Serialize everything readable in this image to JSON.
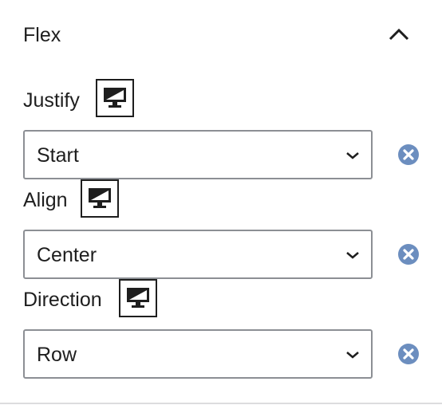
{
  "panel": {
    "title": "Flex",
    "expanded": true
  },
  "fields": [
    {
      "label": "Justify",
      "value": "Start",
      "responsive_icon": "desktop-icon"
    },
    {
      "label": "Align",
      "value": "Center",
      "responsive_icon": "desktop-icon"
    },
    {
      "label": "Direction",
      "value": "Row",
      "responsive_icon": "desktop-icon"
    }
  ],
  "colors": {
    "text": "#1e1e1e",
    "select_border": "#8c8f94",
    "clear_icon": "#6c8ebf",
    "divider": "#dcdcde"
  }
}
